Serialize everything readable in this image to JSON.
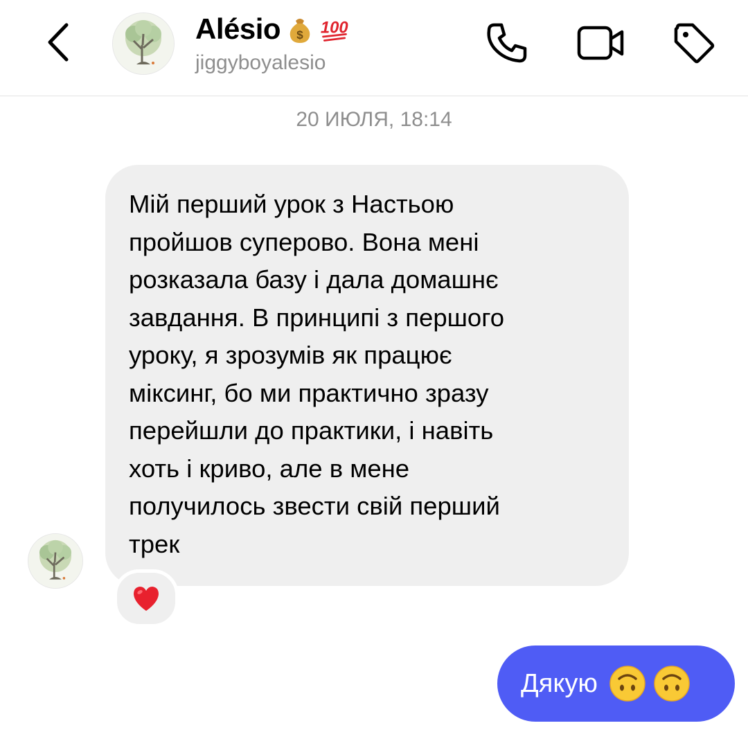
{
  "header": {
    "contact_name": "Alésio",
    "name_emojis": [
      "money-bag-icon",
      "hundred-points-icon"
    ],
    "username": "jiggyboyalesio",
    "actions": [
      "back-icon",
      "phone-icon",
      "video-camera-icon",
      "tag-icon"
    ]
  },
  "thread": {
    "timestamp": "20 ИЮЛЯ, 18:14",
    "incoming_message": {
      "text": "Мій перший урок з Настьою\nпройшов суперово. Вона мені\nрозказала базу і дала домашнє\nзавдання. В принципі з першого\nуроку, я зрозумів як працює\nміксинг, бо ми практично зразу\nперейшли до практики, і навіть\nхоть і криво, але в мене\nполучилось звести свій перший\nтрек",
      "reaction": "red-heart-icon"
    },
    "outgoing_message": {
      "text": "Дякую",
      "emojis": [
        "upside-down-face-icon",
        "upside-down-face-icon"
      ]
    }
  },
  "colors": {
    "incoming_bubble": "#efefef",
    "outgoing_bubble": "#4f5cf5",
    "secondary_text": "#8e8e8e"
  }
}
